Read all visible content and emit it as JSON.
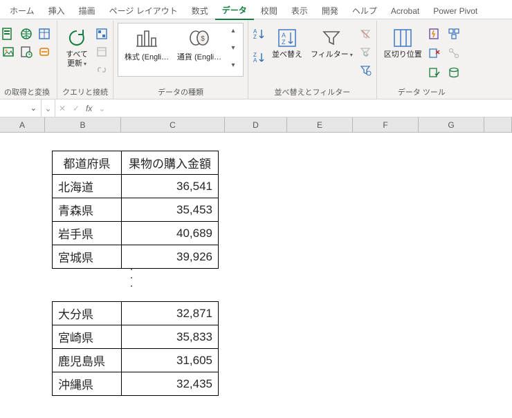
{
  "tabs": {
    "items": [
      {
        "label": "ホーム"
      },
      {
        "label": "挿入"
      },
      {
        "label": "描画"
      },
      {
        "label": "ページ レイアウト"
      },
      {
        "label": "数式"
      },
      {
        "label": "データ"
      },
      {
        "label": "校閲"
      },
      {
        "label": "表示"
      },
      {
        "label": "開発"
      },
      {
        "label": "ヘルプ"
      },
      {
        "label": "Acrobat"
      },
      {
        "label": "Power Pivot"
      }
    ],
    "active_index": 5
  },
  "ribbon": {
    "groups": {
      "get_transform": {
        "label": "の取得と変換"
      },
      "queries": {
        "label": "クエリと接続",
        "refresh_label": "すべて\n更新"
      },
      "data_types": {
        "label": "データの種類",
        "stocks_label": "株式 (Engli…",
        "currency_label": "通貨 (Engli…"
      },
      "sort_filter": {
        "label": "並べ替えとフィルター",
        "sort_label": "並べ替え",
        "filter_label": "フィルター"
      },
      "data_tools": {
        "label": "データ ツール",
        "ttc_label": "区切り位置"
      }
    }
  },
  "formula_bar": {
    "namebox_dropdown": "⌄",
    "fx_label": "fx"
  },
  "columns": [
    "A",
    "B",
    "C",
    "D",
    "E",
    "F",
    "G",
    ""
  ],
  "table": {
    "headers": {
      "pref": "都道府県",
      "amount": "果物の購入金額"
    },
    "rows_top": [
      {
        "pref": "北海道",
        "amount": "36,541"
      },
      {
        "pref": "青森県",
        "amount": "35,453"
      },
      {
        "pref": "岩手県",
        "amount": "40,689"
      },
      {
        "pref": "宮城県",
        "amount": "39,926"
      }
    ],
    "rows_bottom": [
      {
        "pref": "大分県",
        "amount": "32,871"
      },
      {
        "pref": "宮崎県",
        "amount": "35,833"
      },
      {
        "pref": "鹿児島県",
        "amount": "31,605"
      },
      {
        "pref": "沖縄県",
        "amount": "32,435"
      }
    ]
  }
}
